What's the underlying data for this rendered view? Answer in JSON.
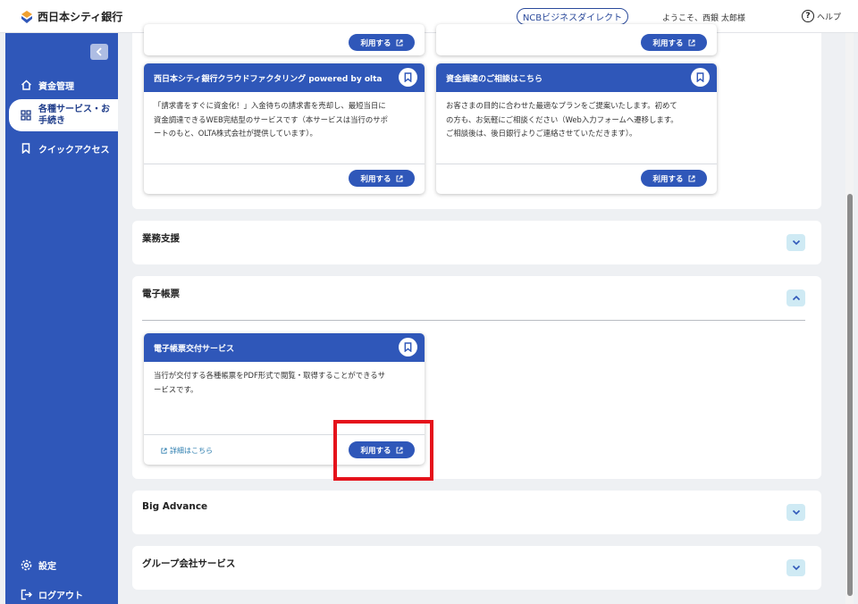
{
  "header": {
    "bank_name": "西日本シティ銀行",
    "ncb_button": "NCBビジネスダイレクト",
    "welcome": "ようこそ、西銀 太郎様",
    "help": "ヘルプ"
  },
  "sidebar": {
    "items": [
      {
        "label": "資金管理",
        "icon": "home-icon"
      },
      {
        "label_line1": "各種サービス・お",
        "label_line2": "手続き",
        "icon": "grid-icon"
      },
      {
        "label": "クイックアクセス",
        "icon": "bookmark-icon"
      }
    ],
    "settings": "設定",
    "logout": "ログアウト"
  },
  "top_cards": {
    "olta": {
      "title": "西日本シティ銀行クラウドファクタリング powered by olta",
      "line1": "「請求書をすぐに資金化！」入金待ちの請求書を売却し、最短当日に",
      "line2": "資金調達できるWEB完結型のサービスです（本サービスは当行のサポ",
      "line3": "ートのもと、OLTA株式会社が提供しています）。",
      "button": "利用する"
    },
    "consult": {
      "title": "資金調達のご相談はこちら",
      "line1": "お客さまの目的に合わせた最適なプランをご提案いたします。初めて",
      "line2": "の方も、お気軽にご相談ください（Web入力フォームへ遷移します。",
      "line3": "ご相談後は、後日銀行よりご連絡させていただきます）。",
      "button": "利用する"
    },
    "prev_left_button": "利用する",
    "prev_right_button": "利用する"
  },
  "sections": {
    "business_support": "業務支援",
    "e_forms": "電子帳票",
    "big_advance": "Big Advance",
    "group": "グループ会社サービス"
  },
  "e_form_card": {
    "title": "電子帳票交付サービス",
    "line1": "当行が交付する各種帳票をPDF形式で閲覧・取得することができるサ",
    "line2": "ービスです。",
    "detail_link": "詳細はこちら",
    "button": "利用する"
  },
  "colors": {
    "primary": "#2f57b9",
    "highlight": "#e5121b",
    "expand_bg": "#cfeaf4"
  }
}
